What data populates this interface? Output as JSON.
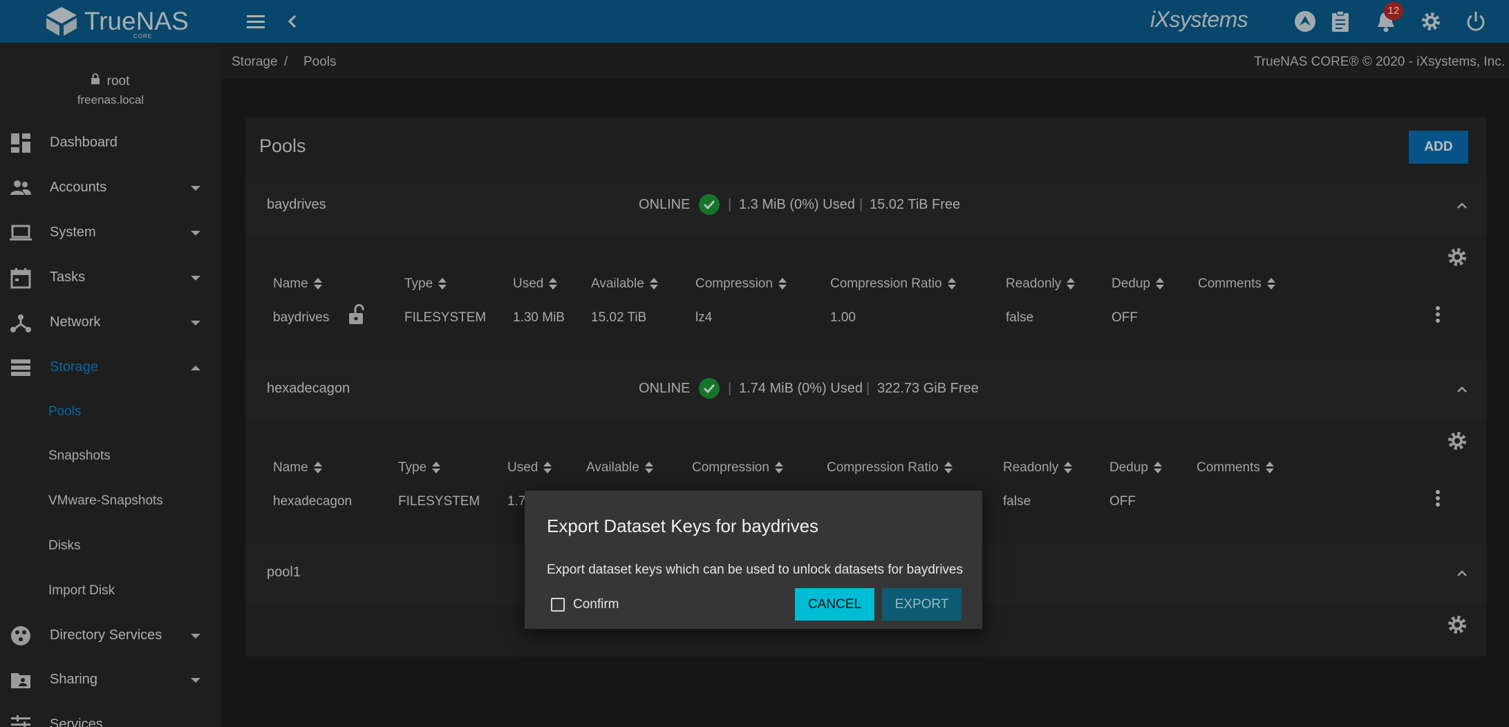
{
  "brand": {
    "name": "TrueNAS",
    "edition": "CORE"
  },
  "topbar": {
    "vendor": "iXsystems",
    "notifications_count": "12"
  },
  "user": {
    "name": "root",
    "host": "freenas.local"
  },
  "nav": {
    "items": [
      {
        "label": "Dashboard",
        "icon": "dashboard-icon"
      },
      {
        "label": "Accounts",
        "icon": "people-icon"
      },
      {
        "label": "System",
        "icon": "laptop-icon"
      },
      {
        "label": "Tasks",
        "icon": "calendar-icon"
      },
      {
        "label": "Network",
        "icon": "network-icon"
      },
      {
        "label": "Storage",
        "icon": "storage-icon"
      },
      {
        "label": "Directory Services",
        "icon": "directory-icon"
      },
      {
        "label": "Sharing",
        "icon": "folder-shared-icon"
      },
      {
        "label": "Services",
        "icon": "tune-icon"
      }
    ],
    "storage_sub": [
      "Pools",
      "Snapshots",
      "VMware-Snapshots",
      "Disks",
      "Import Disk"
    ]
  },
  "breadcrumb": {
    "storage": "Storage",
    "sep": "/",
    "pools": "Pools"
  },
  "copyright": "TrueNAS CORE® © 2020 - iXsystems, Inc.",
  "pools_card": {
    "title": "Pools",
    "add_label": "ADD"
  },
  "columns": [
    "Name",
    "Type",
    "Used",
    "Available",
    "Compression",
    "Compression Ratio",
    "Readonly",
    "Dedup",
    "Comments"
  ],
  "pools": [
    {
      "name": "baydrives",
      "status": "ONLINE",
      "used": "1.3 MiB (0%) Used",
      "free": "15.02 TiB Free",
      "row": {
        "name": "baydrives",
        "type": "FILESYSTEM",
        "used": "1.30 MiB",
        "available": "15.02 TiB",
        "compression": "lz4",
        "ratio": "1.00",
        "readonly": "false",
        "dedup": "OFF",
        "comments": ""
      }
    },
    {
      "name": "hexadecagon",
      "status": "ONLINE",
      "used": "1.74 MiB (0%) Used",
      "free": "322.73 GiB Free",
      "row": {
        "name": "hexadecagon",
        "type": "FILESYSTEM",
        "used": "1.7",
        "readonly": "false",
        "dedup": "OFF"
      }
    },
    {
      "name": "pool1"
    }
  ],
  "dialog": {
    "title": "Export Dataset Keys for baydrives",
    "message": "Export dataset keys which can be used to unlock datasets for baydrives",
    "confirm_label": "Confirm",
    "cancel_label": "CANCEL",
    "export_label": "EXPORT"
  },
  "colors": {
    "topbar": "#0b5f8f",
    "accent": "#0a8bd4",
    "cancel": "#00bcd4",
    "online": "#1e9c3a"
  }
}
